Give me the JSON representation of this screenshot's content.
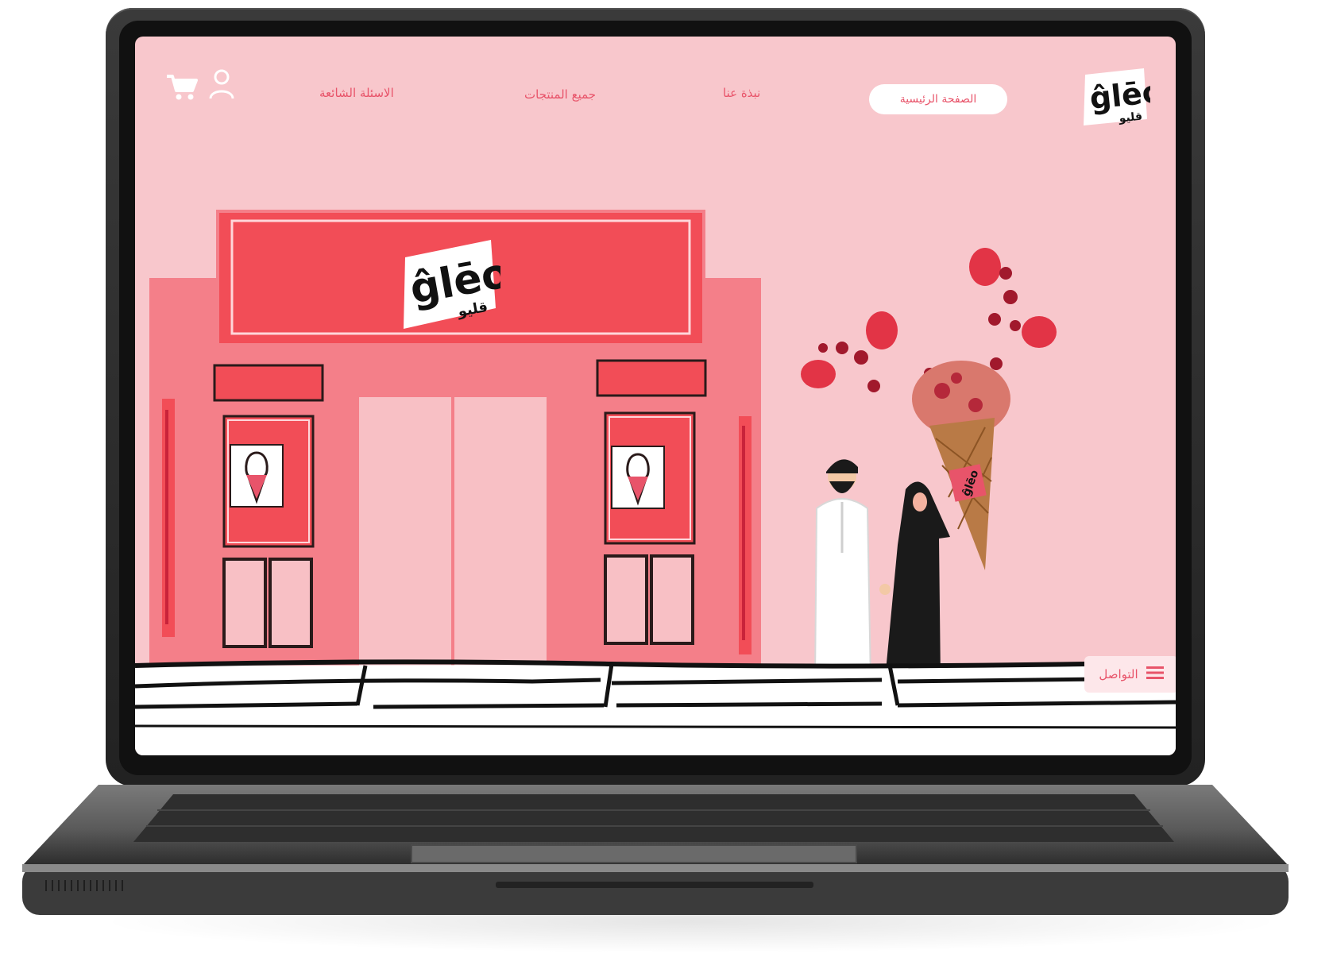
{
  "header": {
    "nav": {
      "home": "الصفحة الرئيسية",
      "about": "نبذة عنا",
      "products": "جميع المنتجات",
      "faq": "الاسئلة الشائعة"
    },
    "icons": [
      "cart-icon",
      "user-icon"
    ]
  },
  "brand": {
    "logo_text": "ĝlēo",
    "logo_sub": "قليو"
  },
  "contact_button": {
    "label": "التواصل",
    "icon": "menu-icon"
  },
  "colors": {
    "screen_bg": "#f8c7cc",
    "accent": "#e8546a",
    "store_red": "#f24d57",
    "store_pink": "#f47f89"
  }
}
